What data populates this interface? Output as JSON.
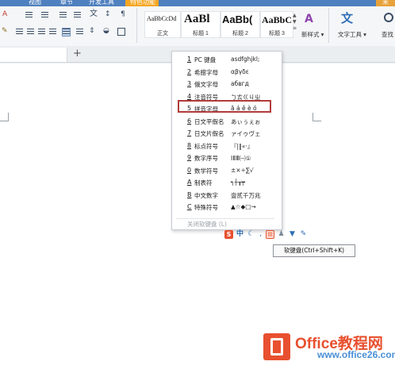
{
  "ribbon": {
    "menu": [
      "视图",
      "章节",
      "开发工具",
      "特色功能"
    ],
    "corner_label": "未",
    "styles": [
      {
        "sample": "AaBbCcDd",
        "label": "正文"
      },
      {
        "sample": "AaBl",
        "label": "标题 1"
      },
      {
        "sample": "AaBb(",
        "label": "标题 2"
      },
      {
        "sample": "AaBbC",
        "label": "标题 3"
      }
    ],
    "new_style": "新样式",
    "text_tools": "文字工具",
    "find": "查找"
  },
  "tabs": {
    "add": "+"
  },
  "popup": {
    "items": [
      {
        "key": "1",
        "name": "PC 键盘",
        "sample": "asdfghjkl;"
      },
      {
        "key": "2",
        "name": "希腊字母",
        "sample": "αβγδε"
      },
      {
        "key": "3",
        "name": "俄文字母",
        "sample": "абвгд"
      },
      {
        "key": "4",
        "name": "注音符号",
        "sample": "ㄅㄊㄍㄐㄓ"
      },
      {
        "key": "5",
        "name": "拼音字母",
        "sample": "ā á ě è ó"
      },
      {
        "key": "6",
        "name": "日文平假名",
        "sample": "あぃぅぇぉ"
      },
      {
        "key": "7",
        "name": "日文片假名",
        "sample": "ァイゥヴェ"
      },
      {
        "key": "8",
        "name": "标点符号",
        "sample": "『|‖«·』"
      },
      {
        "key": "9",
        "name": "数字序号",
        "sample": "ⅠⅡⅢ㈠①"
      },
      {
        "key": "0",
        "name": "数学符号",
        "sample": "±×÷∑√"
      },
      {
        "key": "A",
        "name": "制表符",
        "sample": "┑┼┰┯"
      },
      {
        "key": "B",
        "name": "中文数字",
        "sample": "壹贰千万兆"
      },
      {
        "key": "C",
        "name": "特殊符号",
        "sample": "▲☆◆□→"
      }
    ],
    "close": "关闭软键盘 (L)"
  },
  "tooltip": "软键盘(Ctrl+Shift+K)",
  "watermark": {
    "brand": "Office教程网",
    "sub": "www.office26.com"
  },
  "colors": {
    "accent": "#4f80bf",
    "highlight": "#b23b3b",
    "logo": "#e8502f"
  }
}
